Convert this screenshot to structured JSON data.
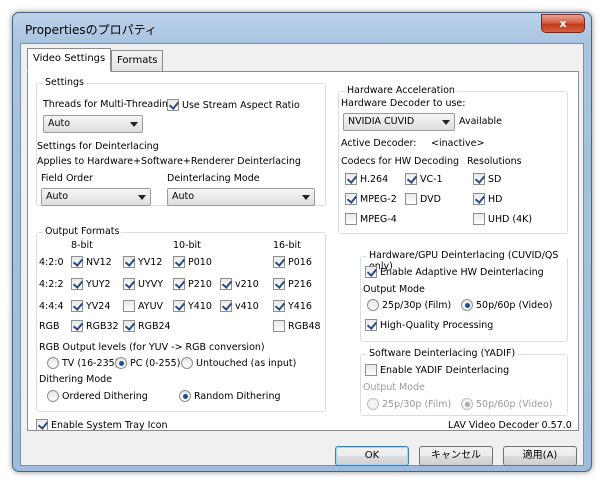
{
  "window": {
    "title": "Propertiesのプロパティ",
    "close_symbol": "x"
  },
  "tabs": [
    {
      "label": "Video Settings"
    },
    {
      "label": "Formats"
    }
  ],
  "settings": {
    "title": "Settings",
    "threads_label": "Threads for Multi-Threading",
    "threads_value": "Auto",
    "stream_aspect_label": "Use Stream Aspect Ratio",
    "deint_title": "Settings for Deinterlacing",
    "deint_desc": "Applies to Hardware+Software+Renderer Deinterlacing",
    "field_order_label": "Field Order",
    "field_order_value": "Auto",
    "deint_mode_label": "Deinterlacing Mode",
    "deint_mode_value": "Auto"
  },
  "output_formats": {
    "title": "Output Formats",
    "col_headers": {
      "c8": "8-bit",
      "c10": "10-bit",
      "c16": "16-bit"
    },
    "rows": {
      "r420": "4:2:0",
      "r422": "4:2:2",
      "r444": "4:4:4",
      "rgb": "RGB"
    },
    "formats": {
      "nv12": "NV12",
      "yv12": "YV12",
      "p010": "P010",
      "p016": "P016",
      "yuy2": "YUY2",
      "uyvy": "UYVY",
      "p210": "P210",
      "v210": "v210",
      "p216": "P216",
      "yv24": "YV24",
      "ayuv": "AYUV",
      "y410": "Y410",
      "v410": "v410",
      "y416": "Y416",
      "rgb32": "RGB32",
      "rgb24": "RGB24",
      "rgb48": "RGB48"
    },
    "levels_label": "RGB Output levels (for YUV -> RGB conversion)",
    "levels": {
      "tv": "TV (16-235)",
      "pc": "PC (0-255)",
      "untouched": "Untouched (as input)"
    },
    "dithering_label": "Dithering Mode",
    "dithering": {
      "ordered": "Ordered Dithering",
      "random": "Random Dithering"
    }
  },
  "tray_icon_label": "Enable System Tray Icon",
  "hw_accel": {
    "title": "Hardware Acceleration",
    "decoder_label": "Hardware Decoder to use:",
    "decoder_value": "NVIDIA CUVID",
    "available": "Available",
    "active_label": "Active Decoder:",
    "active_value": "<inactive>",
    "codecs_label": "Codecs for HW Decoding",
    "resolutions_label": "Resolutions",
    "codecs": {
      "h264": "H.264",
      "vc1": "VC-1",
      "mpeg2": "MPEG-2",
      "dvd": "DVD",
      "mpeg4": "MPEG-4"
    },
    "resolutions": {
      "sd": "SD",
      "hd": "HD",
      "uhd": "UHD (4K)"
    }
  },
  "hw_deint": {
    "title": "Hardware/GPU Deinterlacing (CUVID/QS only)",
    "enable_label": "Enable Adaptive HW Deinterlacing",
    "output_mode_label": "Output Mode",
    "film": "25p/30p (Film)",
    "video": "50p/60p (Video)",
    "hq_label": "High-Quality Processing"
  },
  "sw_deint": {
    "title": "Software Deinterlacing (YADIF)",
    "enable_label": "Enable YADIF Deinterlacing",
    "output_mode_label": "Output Mode",
    "film": "25p/30p (Film)",
    "video": "50p/60p (Video)"
  },
  "version": "LAV Video Decoder 0.57.0",
  "buttons": {
    "ok": "OK",
    "cancel": "キャンセル",
    "apply": "適用(A)"
  }
}
